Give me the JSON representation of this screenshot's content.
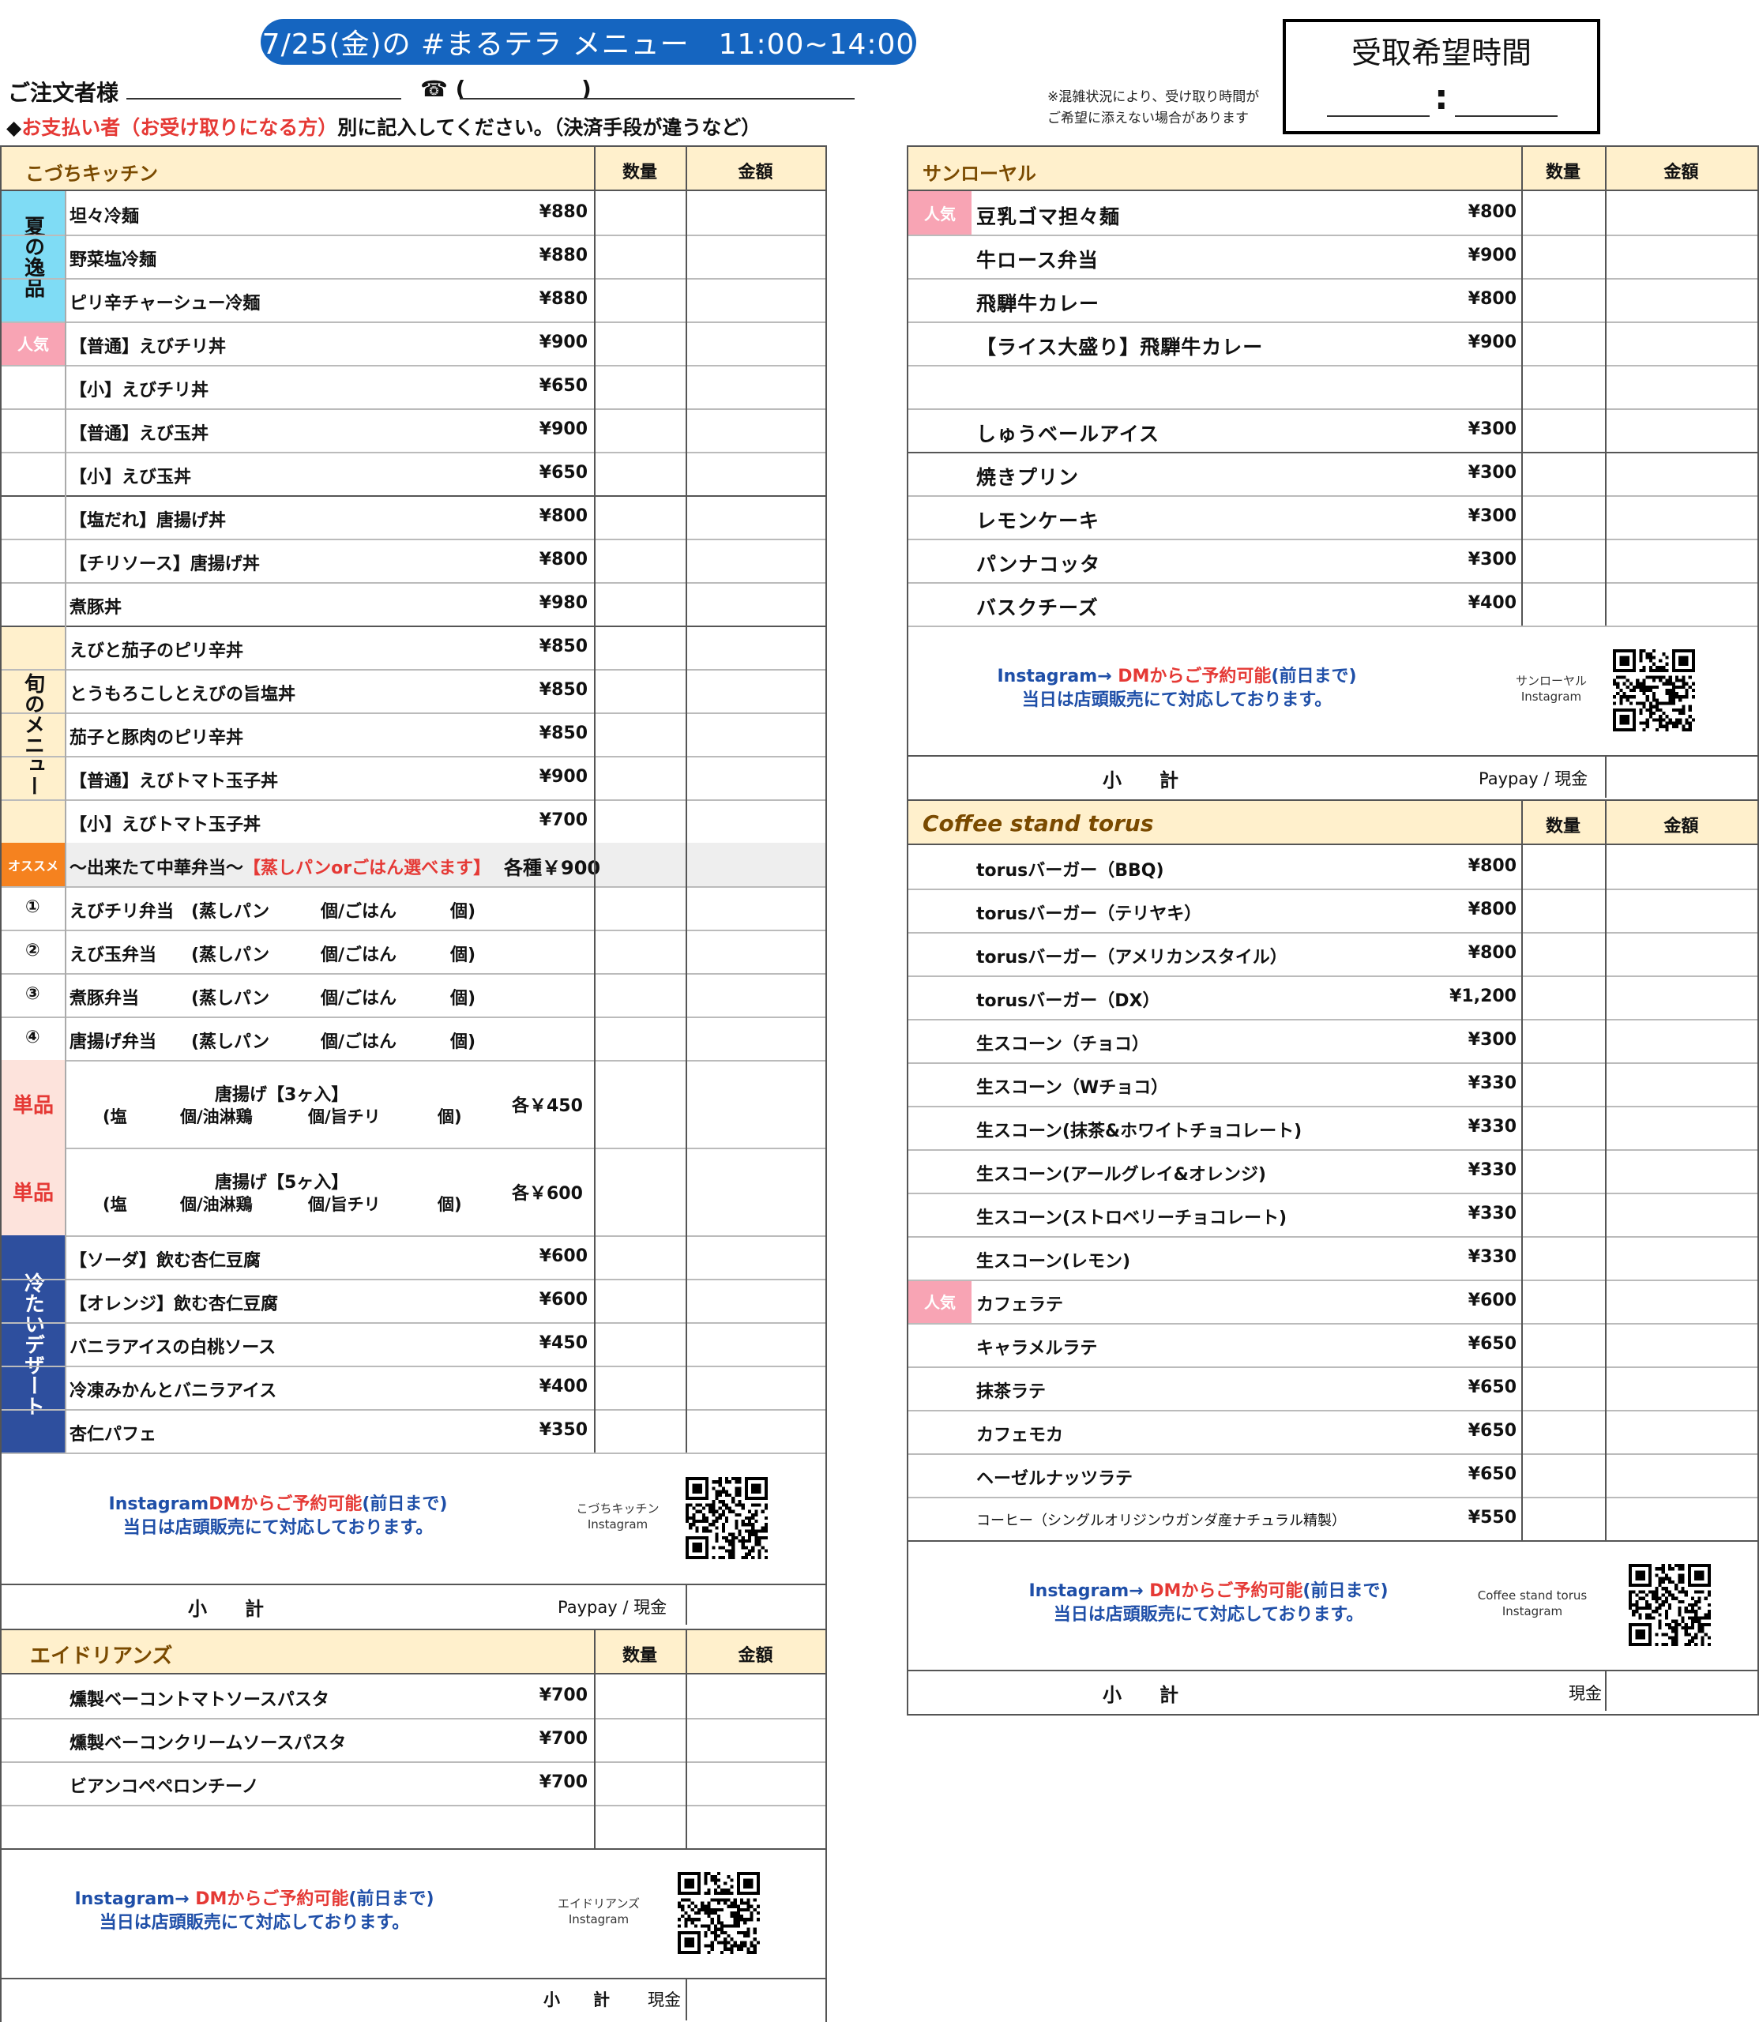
{
  "header": {
    "title": "7/25(金)の #まるテラ メニュー　11:00~14:00",
    "orderer_label": "ご注文者様",
    "phone_label": "☎ (",
    "phone_close": ")",
    "note_prefix": "◆",
    "note_red": "お支払い者（お受け取りになる方）",
    "note_rest": "別に記入してください。（決済手段が違うなど）",
    "pickup_title": "受取希望時間",
    "pickup_colon": ":",
    "congestion_note_1": "※混雑状況により、受け取り時間が",
    "congestion_note_2": "ご希望に添えない場合があります"
  },
  "colors": {
    "banner": "#1565c0",
    "header_bg": "#fff0cc",
    "popular": "#f8a4b4",
    "summer": "#7fdcf5",
    "seasonal": "#fff0cc",
    "osusume": "#f5821f",
    "tanpin_bg": "#fde3dc",
    "dessert": "#2e4f9e"
  },
  "common": {
    "qty": "数量",
    "amount": "金額",
    "subtotal": "小　　計",
    "paypay_cash": "Paypay / 現金",
    "cash": "現金",
    "popular_badge": "人気",
    "tanpin": "単品",
    "osusume": "オススメ",
    "ig_line1_a": "Instagram→ ",
    "ig_line1_b": "DMからご予約可能",
    "ig_line1_c": "(前日まで)",
    "ig_line2": "当日は店頭販売にて対応しております。",
    "ig_label": "Instagram",
    "ig_dm_a": "Instagram",
    "ig_dm_b": "DMからご予約可能",
    "ig_dm_c": "(前日まで)"
  },
  "kochi": {
    "name": "こづちキッチン",
    "summer_label": "夏の逸品",
    "seasonal_label": "旬のメニュー",
    "dessert_label": "冷たいデザート",
    "items": [
      {
        "name": "坦々冷麺",
        "price": "¥880"
      },
      {
        "name": "野菜塩冷麺",
        "price": "¥880"
      },
      {
        "name": "ピリ辛チャーシュー冷麺",
        "price": "¥880"
      },
      {
        "name": "【普通】えびチリ丼",
        "price": "¥900"
      },
      {
        "name": "【小】えびチリ丼",
        "price": "¥650"
      },
      {
        "name": "【普通】えび玉丼",
        "price": "¥900"
      },
      {
        "name": "【小】えび玉丼",
        "price": "¥650"
      },
      {
        "name": "【塩だれ】唐揚げ丼",
        "price": "¥800"
      },
      {
        "name": "【チリソース】唐揚げ丼",
        "price": "¥800"
      },
      {
        "name": "煮豚丼",
        "price": "¥980"
      },
      {
        "name": "えびと茄子のピリ辛丼",
        "price": "¥850"
      },
      {
        "name": "とうもろこしとえびの旨塩丼",
        "price": "¥850"
      },
      {
        "name": "茄子と豚肉のピリ辛丼",
        "price": "¥850"
      },
      {
        "name": "【普通】えびトマト玉子丼",
        "price": "¥900"
      },
      {
        "name": "【小】えびトマト玉子丼",
        "price": "¥700"
      }
    ],
    "bento_title_a": "〜出来たて中華弁当〜",
    "bento_title_b": "【蒸しパンorごはん選べます】",
    "bento_price": "各種￥900",
    "bento": [
      {
        "num": "①",
        "name": "えびチリ弁当"
      },
      {
        "num": "②",
        "name": "えび玉弁当"
      },
      {
        "num": "③",
        "name": "煮豚弁当"
      },
      {
        "num": "④",
        "name": "唐揚げ弁当"
      }
    ],
    "bento_opt_a": "(蒸しパン",
    "bento_opt_b": "個/ごはん",
    "bento_opt_c": "個)",
    "karaage": [
      {
        "title": "唐揚げ【3ヶ入】",
        "price": "各￥450"
      },
      {
        "title": "唐揚げ【5ヶ入】",
        "price": "各￥600"
      }
    ],
    "karaage_opt_a": "(塩",
    "karaage_opt_b": "個/油淋鶏",
    "karaage_opt_c": "個/旨チリ",
    "karaage_opt_d": "個)",
    "desserts": [
      {
        "name": "【ソーダ】飲む杏仁豆腐",
        "price": "¥600"
      },
      {
        "name": "【オレンジ】飲む杏仁豆腐",
        "price": "¥600"
      },
      {
        "name": "バニラアイスの白桃ソース",
        "price": "¥450"
      },
      {
        "name": "冷凍みかんとバニラアイス",
        "price": "¥400"
      },
      {
        "name": "杏仁パフェ",
        "price": "¥350"
      }
    ],
    "shop_ig": "こづちキッチン"
  },
  "aidrians": {
    "name": "エイドリアンズ",
    "items": [
      {
        "name": "燻製ベーコントマトソースパスタ",
        "price": "¥700"
      },
      {
        "name": "燻製ベーコンクリームソースパスタ",
        "price": "¥700"
      },
      {
        "name": "ビアンコペペロンチーノ",
        "price": "¥700"
      }
    ],
    "shop_ig": "エイドリアンズ"
  },
  "sanroyal": {
    "name": "サンローヤル",
    "items": [
      {
        "name": "豆乳ゴマ担々麺",
        "price": "¥800"
      },
      {
        "name": "牛ロース弁当",
        "price": "¥900"
      },
      {
        "name": "飛騨牛カレー",
        "price": "¥800"
      },
      {
        "name": "【ライス大盛り】飛騨牛カレー",
        "price": "¥900"
      },
      {
        "name": "",
        "price": ""
      },
      {
        "name": "しゅうベールアイス",
        "price": "¥300"
      },
      {
        "name": "焼きプリン",
        "price": "¥300"
      },
      {
        "name": "レモンケーキ",
        "price": "¥300"
      },
      {
        "name": "パンナコッタ",
        "price": "¥300"
      },
      {
        "name": "バスクチーズ",
        "price": "¥400"
      }
    ],
    "shop_ig": "サンローヤル"
  },
  "torus": {
    "name": "Coffee stand torus",
    "items": [
      {
        "name": "torusバーガー（BBQ)",
        "price": "¥800"
      },
      {
        "name": "torusバーガー（テリヤキ）",
        "price": "¥800"
      },
      {
        "name": "torusバーガー（アメリカンスタイル）",
        "price": "¥800"
      },
      {
        "name": "torusバーガー（DX）",
        "price": "¥1,200"
      },
      {
        "name": "生スコーン（チョコ）",
        "price": "¥300"
      },
      {
        "name": "生スコーン（Wチョコ）",
        "price": "¥330"
      },
      {
        "name": "生スコーン(抹茶&ホワイトチョコレート)",
        "price": "¥330"
      },
      {
        "name": "生スコーン(アールグレイ&オレンジ)",
        "price": "¥330"
      },
      {
        "name": "生スコーン(ストロベリーチョコレート)",
        "price": "¥330"
      },
      {
        "name": "生スコーン(レモン)",
        "price": "¥330"
      },
      {
        "name": "カフェラテ",
        "price": "¥600"
      },
      {
        "name": "キャラメルラテ",
        "price": "¥650"
      },
      {
        "name": "抹茶ラテ",
        "price": "¥650"
      },
      {
        "name": "カフェモカ",
        "price": "¥650"
      },
      {
        "name": "ヘーゼルナッツラテ",
        "price": "¥650"
      },
      {
        "name": "コーヒー（シングルオリジンウガンダ産ナチュラル精製）",
        "price": "¥550"
      }
    ],
    "shop_ig": "Coffee stand torus"
  }
}
